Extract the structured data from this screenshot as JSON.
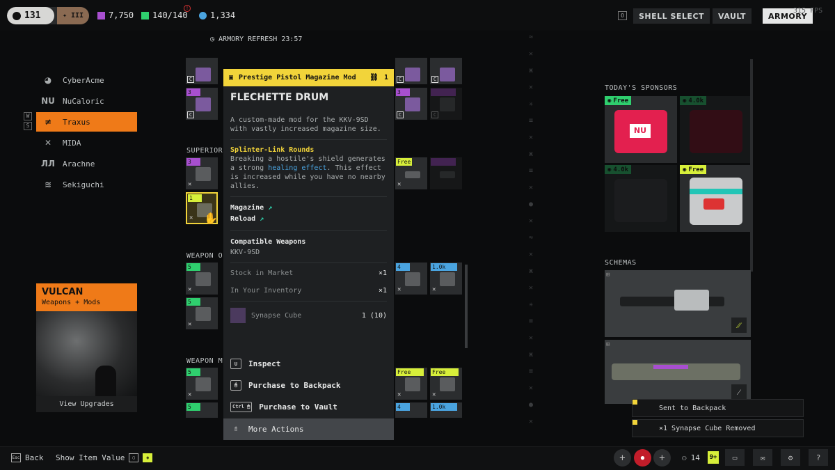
{
  "topbar": {
    "level": "131",
    "rank": "III",
    "currency_purple": "7,750",
    "capacity": "140/140",
    "currency_blue": "1,334",
    "key_hint": "O",
    "buttons": [
      "SHELL SELECT",
      "VAULT",
      "ARMORY"
    ],
    "fps": "315 FPS"
  },
  "armory_refresh": "ARMORY REFRESH 23:57",
  "factions": [
    {
      "name": "CyberAcme",
      "icon": "cyberacme-icon",
      "glyph": "◕"
    },
    {
      "name": "NuCaloric",
      "icon": "nucaloric-icon",
      "glyph": "NU"
    },
    {
      "name": "Traxus",
      "icon": "traxus-icon",
      "glyph": "≠"
    },
    {
      "name": "MIDA",
      "icon": "mida-icon",
      "glyph": "✕"
    },
    {
      "name": "Arachne",
      "icon": "arachne-icon",
      "glyph": "ЛЛ"
    },
    {
      "name": "Sekiguchi",
      "icon": "sekiguchi-icon",
      "glyph": "≋"
    }
  ],
  "active_faction_index": 2,
  "faction_keys": [
    "W",
    "S"
  ],
  "vulcan": {
    "name": "VULCAN",
    "subtitle": "Weapons + Mods",
    "footer": "View Upgrades"
  },
  "sections": {
    "superior": "SUPERIOR",
    "weapon_o": "WEAPON O",
    "weapon_m": "WEAPON M"
  },
  "tiles": {
    "purple_3": "3",
    "selected": "1",
    "green_5": "5",
    "blue_4": "4",
    "blue_1k": "1.0k",
    "free": "Free"
  },
  "tooltip": {
    "category": "Prestige Pistol Magazine Mod",
    "count": "1",
    "title": "FLECHETTE DRUM",
    "description": "A custom-made mod for the KKV-9SD with vastly increased magazine size.",
    "perk_name": "Splinter-Link Rounds",
    "perk_text_1": "Breaking a hostile's shield generates a strong",
    "perk_highlight": "healing effect",
    "perk_text_2": ". This effect is increased while you have no nearby allies.",
    "stats": [
      "Magazine",
      "Reload"
    ],
    "compatible_label": "Compatible Weapons",
    "compatible_value": "KKV-9SD",
    "stock_label": "Stock in Market",
    "stock_value": "×1",
    "inventory_label": "In Your Inventory",
    "inventory_value": "×1",
    "cost_label": "Synapse Cube",
    "cost_value": "1 (10)",
    "actions": [
      {
        "key": "U",
        "label": "Inspect"
      },
      {
        "key": "🖱",
        "label": "Purchase to Backpack"
      },
      {
        "key": "Ctrl 🖱",
        "label": "Purchase to Vault"
      },
      {
        "key": "🖱",
        "label": "More Actions"
      }
    ]
  },
  "right": {
    "sponsors_label": "TODAY'S SPONSORS",
    "sponsor_tags": [
      "Free",
      "4.0k",
      "4.0k",
      "Free"
    ],
    "schemas_label": "SCHEMAS"
  },
  "notifications": [
    "Sent to Backpack",
    "×1 Synapse Cube Removed"
  ],
  "bottom": {
    "back": "Back",
    "back_key": "Esc",
    "show_value": "Show Item Value",
    "party_count": "14",
    "badge": "9+"
  },
  "colors": {
    "accent_orange": "#ef7a18",
    "tooltip_yellow": "#f2d43a",
    "free_green": "#2fcf6e"
  }
}
